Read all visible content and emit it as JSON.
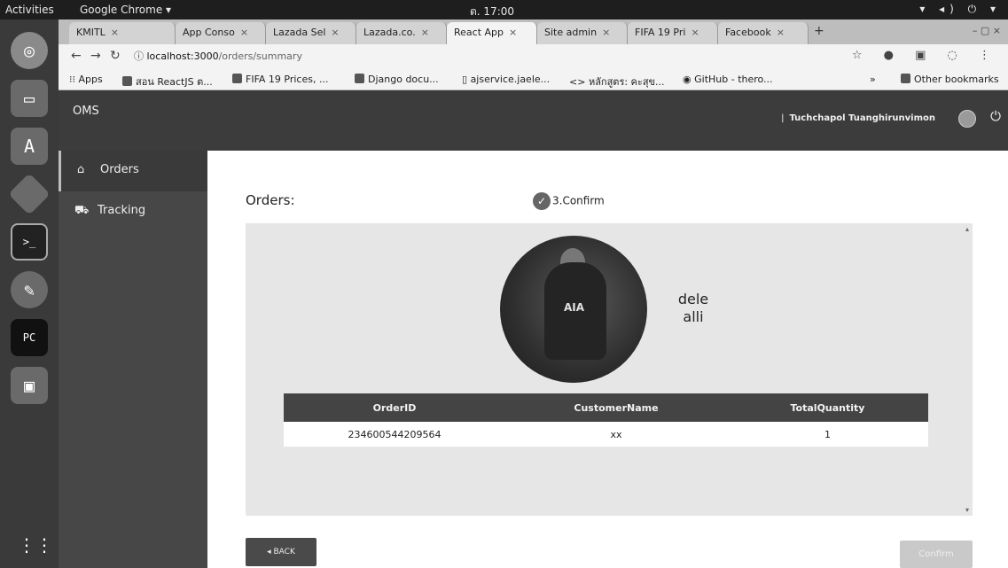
{
  "os": {
    "activities": "Activities",
    "app_menu": "Google Chrome ▾",
    "clock": "ต. 17:00",
    "tray": "▾ ◂) ⏻ ▾"
  },
  "dock": {
    "items": [
      "chrome-icon",
      "files-drawer-icon",
      "software-center-icon",
      "git-icon",
      "terminal-icon",
      "editor-icon",
      "pycharm-icon",
      "file-manager-icon"
    ],
    "terminal_glyph": ">_",
    "pycharm_glyph": "PC"
  },
  "browser": {
    "tabs": [
      {
        "label": "KMITL"
      },
      {
        "label": "App Conso"
      },
      {
        "label": "Lazada Sel"
      },
      {
        "label": "Lazada.co."
      },
      {
        "label": "React App"
      },
      {
        "label": "Site admin"
      },
      {
        "label": "FIFA 19 Pri"
      },
      {
        "label": "Facebook"
      }
    ],
    "new_tab": "+",
    "url_host": "localhost:3000",
    "url_path": "/orders/summary",
    "bookmarks": [
      {
        "label": "Apps"
      },
      {
        "label": "สอน ReactJS ต..."
      },
      {
        "label": "FIFA 19 Prices, ..."
      },
      {
        "label": "Django docu..."
      },
      {
        "label": "ajservice.jaele..."
      },
      {
        "label": "หลักสูตร: คะสุข..."
      },
      {
        "label": "GitHub - thero..."
      }
    ],
    "bookmarks_more": "»",
    "other_bookmarks": "Other bookmarks"
  },
  "app": {
    "brand": "OMS",
    "user_name": "Tuchchapol Tuanghirunvimon",
    "user_sep": "|",
    "nav": [
      {
        "label": "Orders",
        "icon": "home-icon"
      },
      {
        "label": "Tracking",
        "icon": "truck-icon"
      }
    ],
    "heading": "Orders:",
    "step_label": "3.Confirm",
    "player": {
      "first": "dele",
      "last": "alli",
      "sponsor": "AIA"
    },
    "table": {
      "headers": [
        "OrderID",
        "CustomerName",
        "TotalQuantity"
      ],
      "rows": [
        [
          "234600544209564",
          "xx",
          "1"
        ]
      ]
    },
    "back_label": "◂ BACK",
    "confirm_label": "Confirm"
  }
}
